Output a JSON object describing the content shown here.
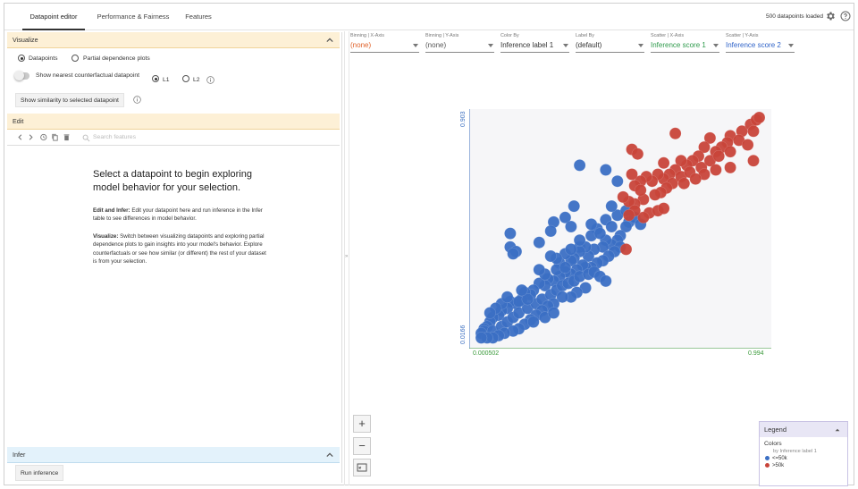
{
  "tabs": [
    {
      "label": "Datapoint editor",
      "active": true
    },
    {
      "label": "Performance & Fairness",
      "active": false
    },
    {
      "label": "Features",
      "active": false
    }
  ],
  "status": {
    "loaded_text": "500 datapoints loaded"
  },
  "visualize": {
    "title": "Visualize",
    "option_datapoints": "Datapoints",
    "option_pdp": "Partial dependence plots",
    "counterfactual_label": "Show nearest counterfactual datapoint",
    "l1_label": "L1",
    "l2_label": "L2",
    "similarity_button": "Show similarity to selected datapoint"
  },
  "edit": {
    "title": "Edit",
    "search_placeholder": "Search features",
    "message_title": "Select a datapoint to begin exploring model behavior for your selection.",
    "p1_bold": "Edit and Infer:",
    "p1_text": " Edit your datapoint here and run inference in the Infer table to see differences in model behavior.",
    "p2_bold": "Visualize:",
    "p2_text": " Switch between visualizing datapoints and exploring partial dependence plots to gain insights into your model's behavior. Explore counterfactuals or see how similar (or different) the rest of your dataset is from your selection."
  },
  "infer": {
    "title": "Infer",
    "run_button": "Run inference"
  },
  "controls": [
    {
      "label": "Binning | X-Axis",
      "value": "(none)",
      "color": "#e0622a"
    },
    {
      "label": "Binning | Y-Axis",
      "value": "(none)",
      "color": "#555555"
    },
    {
      "label": "Color By",
      "value": "Inference label 1",
      "color": "#333333"
    },
    {
      "label": "Label By",
      "value": "(default)",
      "color": "#333333"
    },
    {
      "label": "Scatter | X-Axis",
      "value": "Inference score 1",
      "color": "#2e9a4b"
    },
    {
      "label": "Scatter | Y-Axis",
      "value": "Inference score 2",
      "color": "#2f63c8"
    }
  ],
  "chart_data": {
    "type": "scatter",
    "xlim": [
      0.000502,
      0.994
    ],
    "ylim": [
      0.0166,
      0.903
    ],
    "x_tick_labels": [
      "0.000502",
      "0.994"
    ],
    "y_tick_labels": [
      "0.0166",
      "0.903"
    ],
    "series": [
      {
        "name": "<=50k",
        "color": "#3b6fc4",
        "points": [
          [
            0.36,
            0.78
          ],
          [
            0.45,
            0.76
          ],
          [
            0.34,
            0.6
          ],
          [
            0.31,
            0.55
          ],
          [
            0.27,
            0.53
          ],
          [
            0.33,
            0.51
          ],
          [
            0.26,
            0.49
          ],
          [
            0.12,
            0.48
          ],
          [
            0.49,
            0.71
          ],
          [
            0.45,
            0.54
          ],
          [
            0.42,
            0.5
          ],
          [
            0.22,
            0.44
          ],
          [
            0.4,
            0.47
          ],
          [
            0.36,
            0.42
          ],
          [
            0.53,
            0.53
          ],
          [
            0.52,
            0.51
          ],
          [
            0.5,
            0.47
          ],
          [
            0.49,
            0.45
          ],
          [
            0.47,
            0.43
          ],
          [
            0.45,
            0.45
          ],
          [
            0.44,
            0.42
          ],
          [
            0.41,
            0.41
          ],
          [
            0.39,
            0.38
          ],
          [
            0.38,
            0.42
          ],
          [
            0.36,
            0.4
          ],
          [
            0.34,
            0.37
          ],
          [
            0.33,
            0.36
          ],
          [
            0.31,
            0.39
          ],
          [
            0.29,
            0.35
          ],
          [
            0.28,
            0.37
          ],
          [
            0.12,
            0.42
          ],
          [
            0.14,
            0.4
          ],
          [
            0.13,
            0.39
          ],
          [
            0.5,
            0.42
          ],
          [
            0.48,
            0.4
          ],
          [
            0.46,
            0.38
          ],
          [
            0.44,
            0.36
          ],
          [
            0.42,
            0.35
          ],
          [
            0.4,
            0.33
          ],
          [
            0.38,
            0.33
          ],
          [
            0.37,
            0.34
          ],
          [
            0.35,
            0.32
          ],
          [
            0.33,
            0.3
          ],
          [
            0.31,
            0.31
          ],
          [
            0.29,
            0.29
          ],
          [
            0.27,
            0.27
          ],
          [
            0.25,
            0.28
          ],
          [
            0.24,
            0.25
          ],
          [
            0.22,
            0.26
          ],
          [
            0.2,
            0.23
          ],
          [
            0.19,
            0.21
          ],
          [
            0.17,
            0.22
          ],
          [
            0.16,
            0.19
          ],
          [
            0.14,
            0.17
          ],
          [
            0.12,
            0.18
          ],
          [
            0.11,
            0.15
          ],
          [
            0.09,
            0.14
          ],
          [
            0.08,
            0.12
          ],
          [
            0.06,
            0.11
          ],
          [
            0.05,
            0.09
          ],
          [
            0.04,
            0.07
          ],
          [
            0.03,
            0.06
          ],
          [
            0.03,
            0.05
          ],
          [
            0.02,
            0.04
          ],
          [
            0.06,
            0.05
          ],
          [
            0.09,
            0.07
          ],
          [
            0.11,
            0.09
          ],
          [
            0.13,
            0.11
          ],
          [
            0.15,
            0.13
          ],
          [
            0.18,
            0.15
          ],
          [
            0.21,
            0.17
          ],
          [
            0.23,
            0.19
          ],
          [
            0.26,
            0.21
          ],
          [
            0.28,
            0.23
          ],
          [
            0.3,
            0.25
          ],
          [
            0.32,
            0.26
          ],
          [
            0.34,
            0.27
          ],
          [
            0.36,
            0.29
          ],
          [
            0.39,
            0.3
          ],
          [
            0.41,
            0.31
          ],
          [
            0.43,
            0.29
          ],
          [
            0.45,
            0.27
          ],
          [
            0.38,
            0.24
          ],
          [
            0.35,
            0.22
          ],
          [
            0.33,
            0.2
          ],
          [
            0.3,
            0.2
          ],
          [
            0.27,
            0.17
          ],
          [
            0.25,
            0.16
          ],
          [
            0.23,
            0.14
          ],
          [
            0.21,
            0.12
          ],
          [
            0.19,
            0.1
          ],
          [
            0.17,
            0.08
          ],
          [
            0.15,
            0.06
          ],
          [
            0.13,
            0.05
          ],
          [
            0.1,
            0.04
          ],
          [
            0.08,
            0.03
          ],
          [
            0.06,
            0.02
          ],
          [
            0.04,
            0.02
          ],
          [
            0.02,
            0.02
          ],
          [
            0.09,
            0.17
          ],
          [
            0.11,
            0.2
          ],
          [
            0.07,
            0.15
          ],
          [
            0.05,
            0.13
          ],
          [
            0.15,
            0.18
          ],
          [
            0.18,
            0.19
          ],
          [
            0.2,
            0.09
          ],
          [
            0.24,
            0.11
          ],
          [
            0.27,
            0.13
          ],
          [
            0.16,
            0.23
          ],
          [
            0.24,
            0.3
          ],
          [
            0.22,
            0.32
          ],
          [
            0.28,
            0.32
          ],
          [
            0.31,
            0.33
          ],
          [
            0.33,
            0.41
          ],
          [
            0.26,
            0.38
          ],
          [
            0.36,
            0.45
          ],
          [
            0.4,
            0.52
          ],
          [
            0.43,
            0.48
          ],
          [
            0.47,
            0.51
          ],
          [
            0.49,
            0.56
          ],
          [
            0.55,
            0.55
          ],
          [
            0.57,
            0.52
          ],
          [
            0.52,
            0.58
          ],
          [
            0.47,
            0.6
          ]
        ]
      },
      {
        "name": ">50k",
        "color": "#c8443a",
        "points": [
          [
            0.69,
            0.92
          ],
          [
            0.81,
            0.9
          ],
          [
            0.88,
            0.91
          ],
          [
            0.92,
            0.93
          ],
          [
            0.95,
            0.96
          ],
          [
            0.97,
            0.98
          ],
          [
            0.98,
            0.99
          ],
          [
            0.96,
            0.93
          ],
          [
            0.91,
            0.89
          ],
          [
            0.87,
            0.88
          ],
          [
            0.85,
            0.86
          ],
          [
            0.83,
            0.84
          ],
          [
            0.79,
            0.86
          ],
          [
            0.77,
            0.82
          ],
          [
            0.75,
            0.8
          ],
          [
            0.73,
            0.78
          ],
          [
            0.71,
            0.8
          ],
          [
            0.69,
            0.76
          ],
          [
            0.67,
            0.74
          ],
          [
            0.65,
            0.72
          ],
          [
            0.63,
            0.74
          ],
          [
            0.61,
            0.71
          ],
          [
            0.59,
            0.73
          ],
          [
            0.57,
            0.71
          ],
          [
            0.55,
            0.69
          ],
          [
            0.54,
            0.74
          ],
          [
            0.54,
            0.85
          ],
          [
            0.56,
            0.83
          ],
          [
            0.65,
            0.79
          ],
          [
            0.68,
            0.7
          ],
          [
            0.71,
            0.73
          ],
          [
            0.74,
            0.75
          ],
          [
            0.78,
            0.77
          ],
          [
            0.81,
            0.8
          ],
          [
            0.84,
            0.82
          ],
          [
            0.88,
            0.84
          ],
          [
            0.94,
            0.87
          ],
          [
            0.96,
            0.8
          ],
          [
            0.88,
            0.77
          ],
          [
            0.83,
            0.76
          ],
          [
            0.79,
            0.74
          ],
          [
            0.76,
            0.72
          ],
          [
            0.72,
            0.7
          ],
          [
            0.66,
            0.68
          ],
          [
            0.64,
            0.66
          ],
          [
            0.62,
            0.65
          ],
          [
            0.58,
            0.63
          ],
          [
            0.57,
            0.67
          ],
          [
            0.55,
            0.61
          ],
          [
            0.53,
            0.62
          ],
          [
            0.51,
            0.64
          ],
          [
            0.6,
            0.57
          ],
          [
            0.63,
            0.58
          ],
          [
            0.65,
            0.59
          ],
          [
            0.58,
            0.55
          ],
          [
            0.55,
            0.58
          ],
          [
            0.53,
            0.56
          ],
          [
            0.52,
            0.41
          ]
        ]
      }
    ]
  },
  "zoom": {
    "in": "+",
    "out": "−"
  },
  "legend": {
    "title": "Legend",
    "section": "Colors",
    "by": "by Inference label 1",
    "items": [
      {
        "label": "<=50k",
        "color": "#3b6fc4"
      },
      {
        "label": ">50k",
        "color": "#c8443a"
      }
    ]
  }
}
